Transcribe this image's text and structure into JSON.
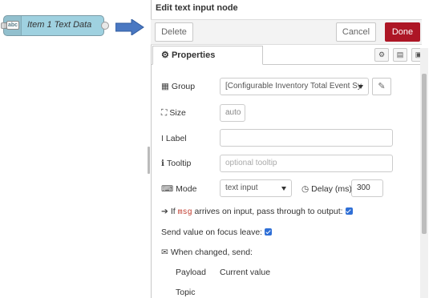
{
  "node": {
    "icon_text": "abc",
    "label": "Item 1 Text Data"
  },
  "editor": {
    "title": "Edit text input node",
    "delete_label": "Delete",
    "cancel_label": "Cancel",
    "done_label": "Done",
    "tab_label": "Properties"
  },
  "form": {
    "group": {
      "label": "Group",
      "value": "[Configurable Inventory Total Event Sy"
    },
    "size": {
      "label": "Size",
      "value": "auto"
    },
    "label_field": {
      "label": "Label",
      "value": ""
    },
    "tooltip": {
      "label": "Tooltip",
      "placeholder": "optional tooltip"
    },
    "mode": {
      "label": "Mode",
      "value": "text input"
    },
    "delay": {
      "label": "Delay (ms)",
      "value": "300"
    },
    "passthrough": {
      "prefix": "If",
      "code": "msg",
      "suffix": "arrives on input, pass through to output:",
      "checked": true
    },
    "focus_leave": {
      "label": "Send value on focus leave:",
      "checked": true
    },
    "when_changed": {
      "label": "When changed, send:"
    },
    "payload": {
      "label": "Payload",
      "value": "Current value"
    },
    "topic": {
      "label": "Topic"
    }
  },
  "colors": {
    "done_bg": "#ad1625",
    "node_bg": "#9fd1e0",
    "arrow": "#4a78c2",
    "checkbox": "#2f6fd6"
  }
}
